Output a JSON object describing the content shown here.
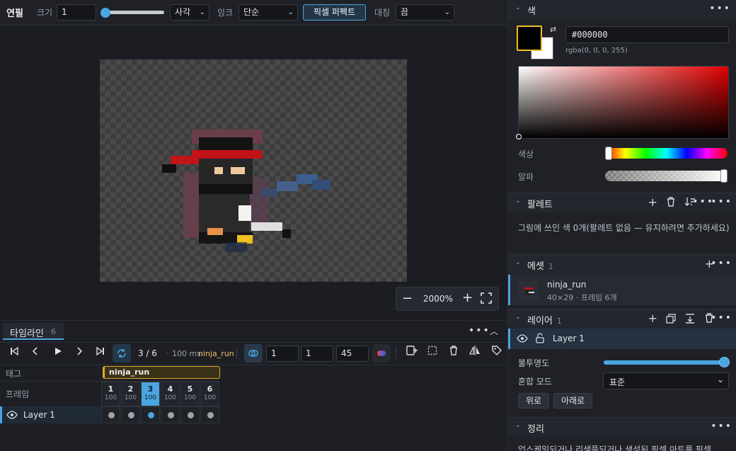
{
  "toolbar": {
    "tool_name": "연필",
    "size_label": "크기",
    "size_value": "1",
    "shape_value": "사각",
    "ink_label": "잉크",
    "ink_value": "단순",
    "pixel_perfect_label": "픽셀 퍼펙트",
    "symmetry_label": "대칭",
    "symmetry_value": "끔"
  },
  "canvas": {
    "zoom": "2000%"
  },
  "timeline": {
    "tab_label": "타임라인",
    "tab_count": "6",
    "frame_position": "3 / 6",
    "frame_duration": "100 ms",
    "tag_name": "ninja_run",
    "onion_values": [
      "1",
      "1",
      "45"
    ],
    "tag_row_label": "태그",
    "frame_row_label": "프레임",
    "layer_name": "Layer 1",
    "frames": [
      {
        "n": "1",
        "d": "100"
      },
      {
        "n": "2",
        "d": "100"
      },
      {
        "n": "3",
        "d": "100"
      },
      {
        "n": "4",
        "d": "100"
      },
      {
        "n": "5",
        "d": "100"
      },
      {
        "n": "6",
        "d": "100"
      }
    ],
    "active_frame": 3
  },
  "color": {
    "title": "색",
    "hex": "#000000",
    "rgba": "rgba(0, 0, 0, 255)",
    "hue_label": "색상",
    "alpha_label": "알파",
    "primary": "#000000",
    "secondary": "#ffffff",
    "hue_fraction": 0.0,
    "alpha_fraction": 1.0
  },
  "palette": {
    "title": "팔레트",
    "message": "그림에 쓰인 색 0개(팔레트 없음 — 유지하려면 추가하세요)"
  },
  "assets": {
    "title": "에셋",
    "count": "1",
    "item_name": "ninja_run",
    "item_meta": "40×29 · 프레임 6개"
  },
  "layers": {
    "title": "레이어",
    "count": "1",
    "layer_name": "Layer 1",
    "opacity_label": "불투명도",
    "opacity_fraction": 1.0,
    "blend_label": "혼합 모드",
    "blend_value": "표준",
    "up_label": "위로",
    "down_label": "아래로"
  },
  "cleanup": {
    "title": "정리",
    "message": "업스케일되거나 리샘플되거나 생성된 픽셀 아트를 픽셀"
  }
}
